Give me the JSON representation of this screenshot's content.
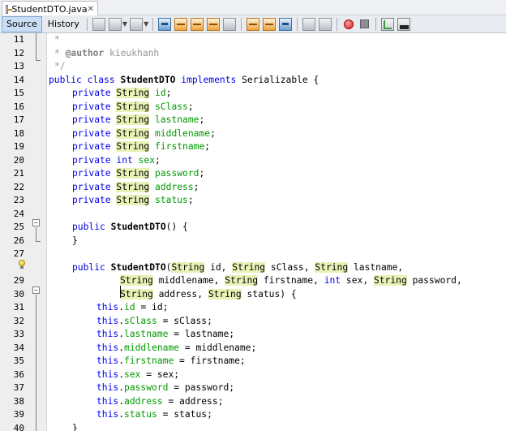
{
  "tab": {
    "title": "StudentDTO.java",
    "close": "✕"
  },
  "toolbar": {
    "source_label": "Source",
    "history_label": "History"
  },
  "gutter": {
    "line_numbers": [
      "11",
      "12",
      "13",
      "14",
      "15",
      "16",
      "17",
      "18",
      "19",
      "20",
      "21",
      "22",
      "23",
      "24",
      "25",
      "26",
      "27",
      "28",
      "29",
      "30",
      "31",
      "32",
      "33",
      "34",
      "35",
      "36",
      "37",
      "38",
      "39",
      "40"
    ],
    "fold_open": "−"
  },
  "code": {
    "l11": "*",
    "l12_prefix": "* ",
    "l12_tag": "@author",
    "l12_rest": " kieukhanh",
    "l13": "*/",
    "kw_public": "public",
    "kw_class": "class",
    "kw_private": "private",
    "kw_implements": "implements",
    "kw_int": "int",
    "kw_this": "this",
    "class_name": "StudentDTO",
    "iface": "Serializable",
    "type_string": "String",
    "fields": [
      "id",
      "sClass",
      "lastname",
      "middlename",
      "firstname",
      "sex",
      "password",
      "address",
      "status"
    ],
    "ctor_empty_tail": "() {",
    "close_brace": "}",
    "open_brace": " {",
    "ctor_line1_params": [
      "id, ",
      "sClass, ",
      "lastname,"
    ],
    "ctor_line2_params": [
      "middlename, ",
      "firstname, ",
      "sex, ",
      "password,"
    ],
    "ctor_line3_params": [
      "address, ",
      "status) {"
    ]
  },
  "icons": {
    "hint": "lightbulb-icon"
  }
}
